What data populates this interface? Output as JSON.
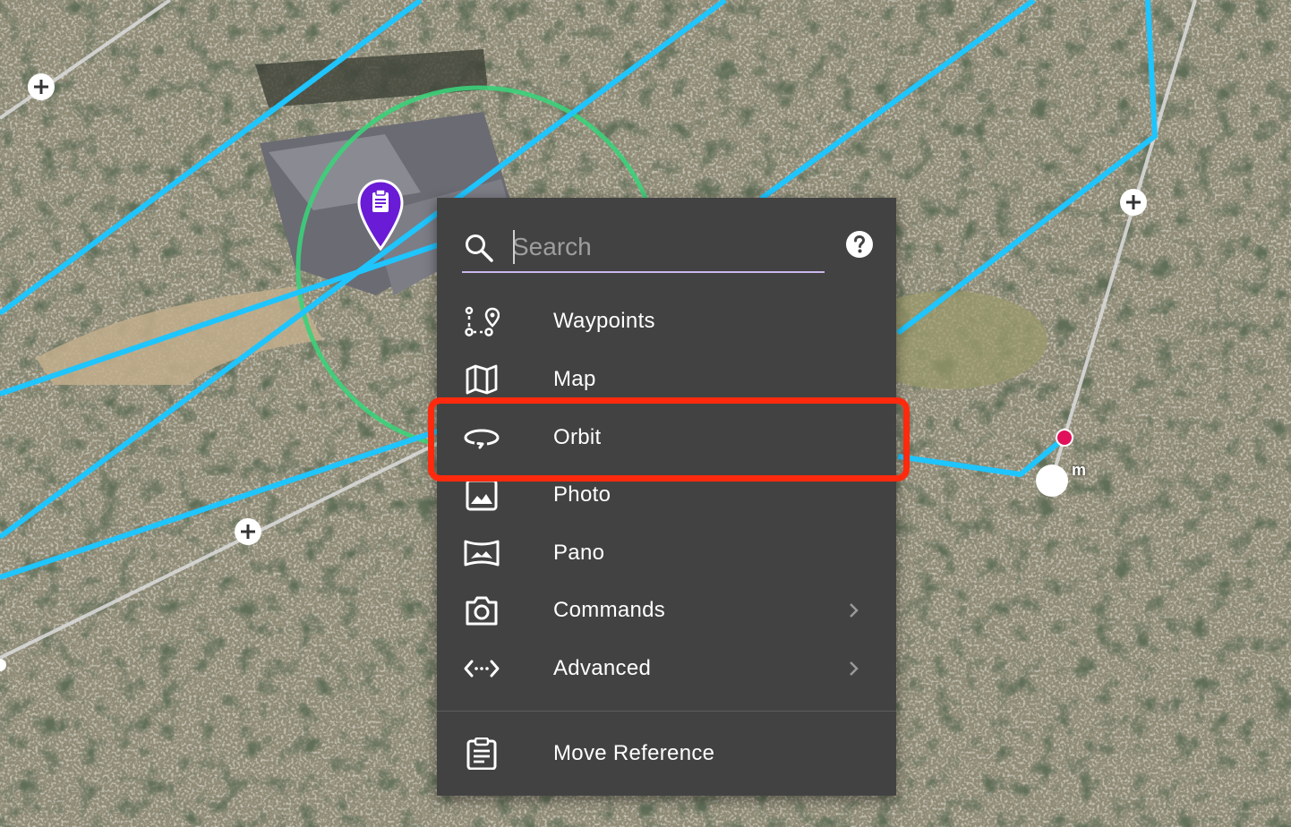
{
  "map": {
    "colors": {
      "path": "#1ec5ff",
      "segment": "#d8d8d8",
      "orbit_circle": "#3bd17a",
      "pin": "#6a1bd6"
    },
    "node_label": "m"
  },
  "search": {
    "placeholder": "Search",
    "value": ""
  },
  "menu": {
    "items": [
      {
        "label": "Waypoints",
        "icon": "waypoints-icon"
      },
      {
        "label": "Map",
        "icon": "map-icon"
      },
      {
        "label": "Orbit",
        "icon": "orbit-icon",
        "highlighted": true
      },
      {
        "label": "Photo",
        "icon": "photo-icon"
      },
      {
        "label": "Pano",
        "icon": "pano-icon"
      },
      {
        "label": "Commands",
        "icon": "camera-icon",
        "submenu": true
      },
      {
        "label": "Advanced",
        "icon": "code-icon",
        "submenu": true
      }
    ],
    "footer_item": {
      "label": "Move Reference",
      "icon": "clipboard-icon"
    }
  },
  "highlight_color": "#ff2a0e"
}
